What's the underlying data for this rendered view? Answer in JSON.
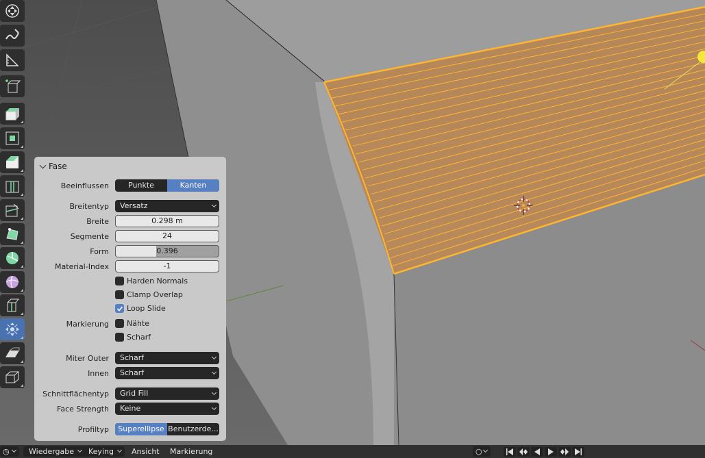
{
  "panel": {
    "title": "Fase",
    "affect": {
      "label": "Beeinflussen",
      "options": [
        "Punkte",
        "Kanten"
      ],
      "selected": "Kanten"
    },
    "width_type": {
      "label": "Breitentyp",
      "value": "Versatz"
    },
    "width": {
      "label": "Breite",
      "value": "0.298 m"
    },
    "segments": {
      "label": "Segmente",
      "value": "24"
    },
    "shape": {
      "label": "Form",
      "value": "0.396",
      "fraction": 0.396
    },
    "material_index": {
      "label": "Material-Index",
      "value": "-1"
    },
    "harden_normals": {
      "label": "Harden Normals",
      "checked": false
    },
    "clamp_overlap": {
      "label": "Clamp Overlap",
      "checked": false
    },
    "loop_slide": {
      "label": "Loop Slide",
      "checked": true
    },
    "mark": {
      "label": "Markierung",
      "seams": {
        "label": "Nähte",
        "checked": false
      },
      "sharp": {
        "label": "Scharf",
        "checked": false
      }
    },
    "miter_outer": {
      "label": "Miter Outer",
      "value": "Scharf"
    },
    "miter_inner": {
      "label": "Innen",
      "value": "Scharf"
    },
    "intersection_type": {
      "label": "Schnittflächentyp",
      "value": "Grid Fill"
    },
    "face_strength": {
      "label": "Face Strength",
      "value": "Keine"
    },
    "profile_type": {
      "label": "Profiltyp",
      "options": [
        "Superellipse",
        "Benutzerde..."
      ],
      "selected": "Superellipse"
    }
  },
  "toolbar": {
    "tools": [
      "move-view-icon",
      "annotate-icon",
      "measure-icon",
      "add-cube-icon",
      "extrude-icon",
      "inset-icon",
      "bevel-icon",
      "loop-cut-icon",
      "knife-icon",
      "poly-build-icon",
      "spin-icon",
      "smooth-icon",
      "edge-slide-icon",
      "shrink-fatten-icon",
      "shear-icon",
      "rip-region-icon"
    ],
    "active": "shrink-fatten-icon"
  },
  "bottom_bar": {
    "playback": "Wiedergabe",
    "keying": "Keying",
    "view": "Ansicht",
    "marker": "Markierung"
  },
  "colors": {
    "selection": "#ffb52e",
    "accent": "#5680c2",
    "panel": "#c9c9c9"
  }
}
